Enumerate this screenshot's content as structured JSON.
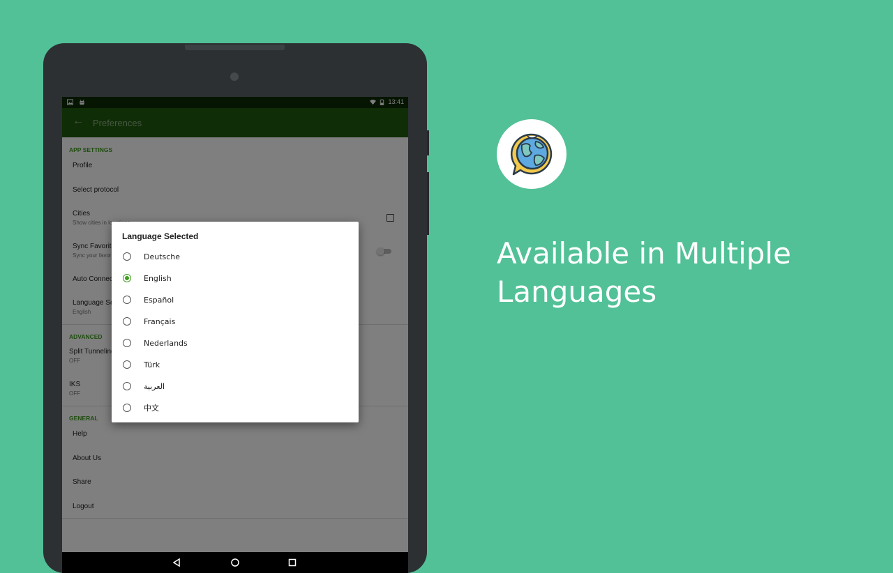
{
  "status_bar": {
    "time": "13:41"
  },
  "app_bar": {
    "title": "Preferences"
  },
  "sections": {
    "app_settings": "APP SETTINGS",
    "advanced": "ADVANCED",
    "general": "GENERAL"
  },
  "settings": {
    "profile": "Profile",
    "select_protocol": "Select protocol",
    "cities": {
      "label": "Cities",
      "sub": "Show cities in locations"
    },
    "sync_favorites": {
      "label": "Sync Favorites",
      "sub": "Sync your favorites"
    },
    "auto_connect": "Auto Connect",
    "language": {
      "label": "Language Selected",
      "sub": "English"
    },
    "split_tunneling": {
      "label": "Split Tunneling",
      "sub": "OFF"
    },
    "iks": {
      "label": "IKS",
      "sub": "OFF"
    },
    "help": "Help",
    "about_us": "About Us",
    "share": "Share",
    "logout": "Logout"
  },
  "dialog": {
    "title": "Language Selected",
    "selected": "English",
    "options": [
      "Deutsche",
      "English",
      "Español",
      "Français",
      "Nederlands",
      "Türk",
      "العربية",
      "中文"
    ]
  },
  "promo": {
    "headline_line1": "Available in Multiple",
    "headline_line2": "Languages",
    "icon": "globe-chat-icon"
  },
  "colors": {
    "background": "#52c197",
    "app_bar": "#1f5a0c",
    "accent": "#3f9d1f"
  }
}
